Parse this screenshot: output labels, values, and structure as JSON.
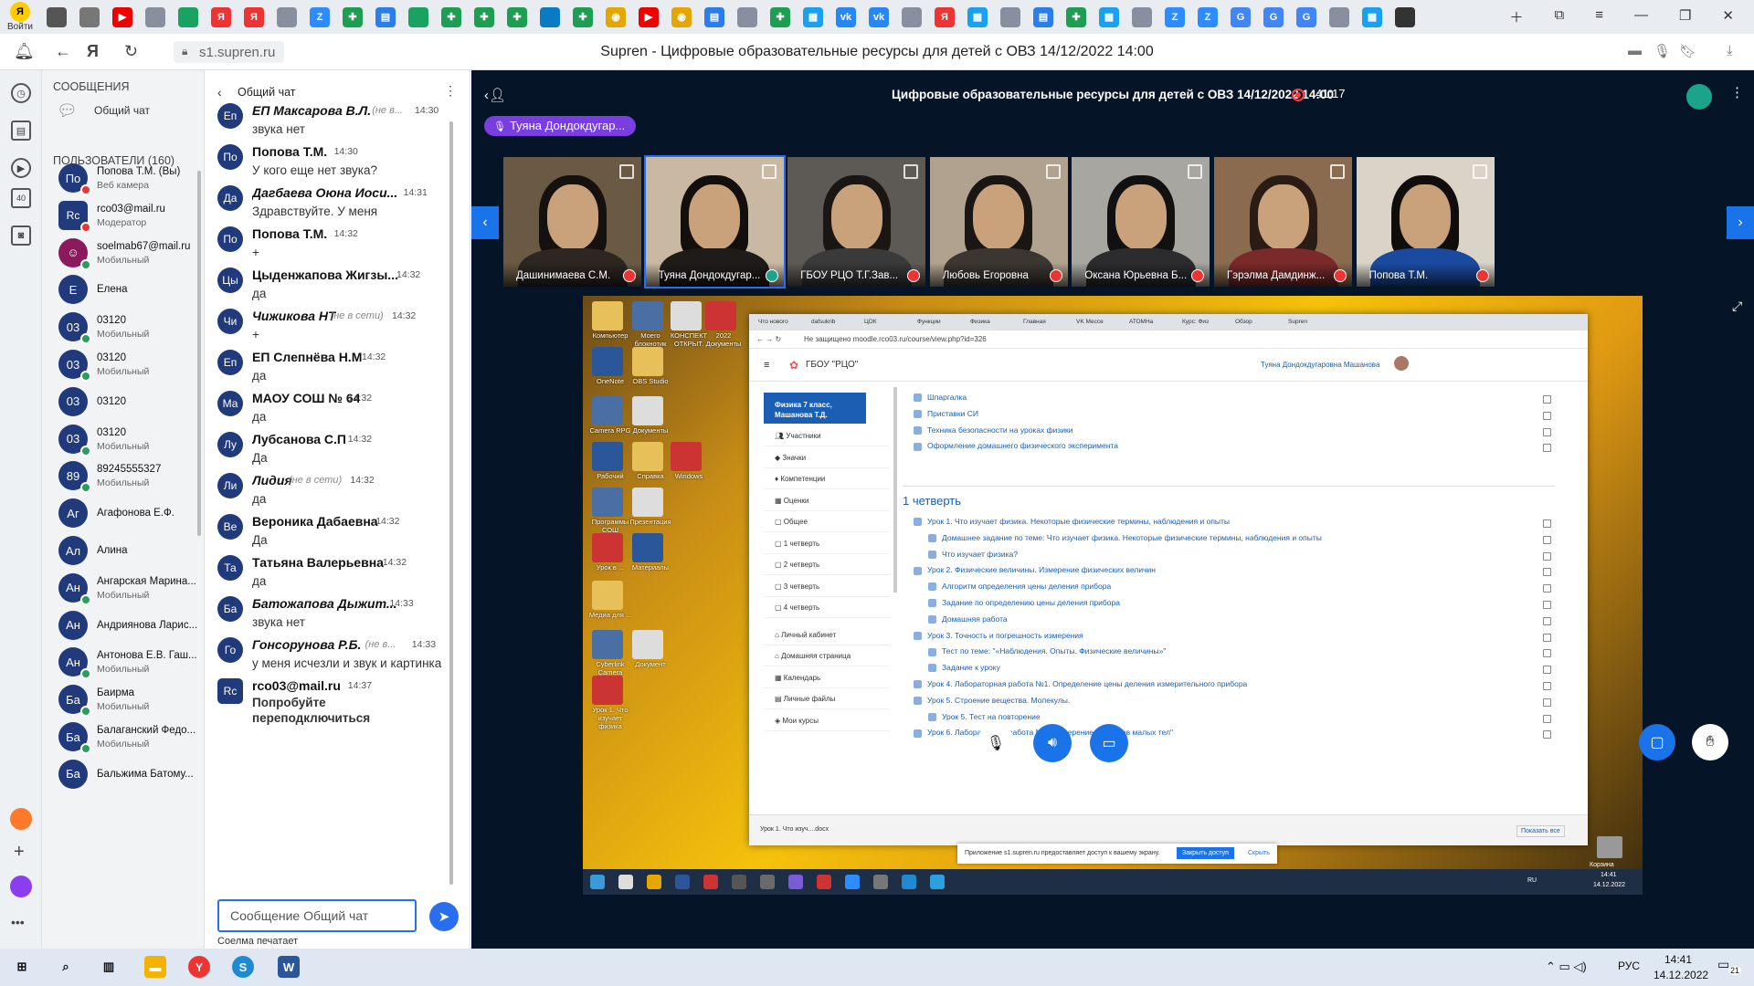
{
  "browser": {
    "login_label": "Войти",
    "url": "s1.supren.ru",
    "page_title": "Supren - Цифровые образовательные ресурсы для детей с ОВЗ 14/12/2022 14:00",
    "tab_icons": [
      "window-icon",
      "folder-icon",
      "youtube-icon",
      "app-icon",
      "drive-icon",
      "yandex-icon",
      "yandex-icon",
      "app-icon",
      "zoom-icon",
      "sheets-icon",
      "docs-icon",
      "drive-icon",
      "sheets-icon",
      "sheets-icon",
      "sheets-icon",
      "edge-icon",
      "sheets-icon",
      "chrome-icon",
      "youtube-icon",
      "chrome-icon",
      "docs-icon",
      "app-icon",
      "sheets-icon",
      "windows-icon",
      "vk-icon",
      "vk-icon",
      "app-icon",
      "yandex-icon",
      "windows-icon",
      "app-icon",
      "docs-icon",
      "sheets-icon",
      "windows-icon",
      "app-icon",
      "zoom-icon",
      "zoom-icon",
      "google-icon",
      "google-icon",
      "google-icon",
      "app-icon",
      "windows-icon",
      "supren-icon"
    ]
  },
  "users_panel": {
    "messages_header": "СООБЩЕНИЯ",
    "general_chat": "Общий чат",
    "users_header": "ПОЛЬЗОВАТЕЛИ (160)",
    "users": [
      {
        "initials": "По",
        "name": "Попова Т.М. (Вы)",
        "sub": "Веб камера",
        "color": "#213a7c",
        "badge": "#e33",
        "rc": false
      },
      {
        "initials": "Rc",
        "name": "rco03@mail.ru",
        "sub": "Модератор",
        "color": "#213a7c",
        "badge": "#e33",
        "rc": true
      },
      {
        "initials": "",
        "name": "soelmab67@mail.ru",
        "sub": "Мобильный",
        "color": "#8a1a5c",
        "badge": "#2a9d5c",
        "rc": false
      },
      {
        "initials": "Е",
        "name": "Елена",
        "sub": "",
        "color": "#213a7c",
        "badge": "",
        "rc": false
      },
      {
        "initials": "03",
        "name": "03120",
        "sub": "Мобильный",
        "color": "#213a7c",
        "badge": "#2a9d5c",
        "rc": false
      },
      {
        "initials": "03",
        "name": "03120",
        "sub": "Мобильный",
        "color": "#213a7c",
        "badge": "#2a9d5c",
        "rc": false
      },
      {
        "initials": "03",
        "name": "03120",
        "sub": "",
        "color": "#213a7c",
        "badge": "",
        "rc": false
      },
      {
        "initials": "03",
        "name": "03120",
        "sub": "Мобильный",
        "color": "#213a7c",
        "badge": "#2a9d5c",
        "rc": false
      },
      {
        "initials": "89",
        "name": "89245555327",
        "sub": "Мобильный",
        "color": "#213a7c",
        "badge": "#2a9d5c",
        "rc": false
      },
      {
        "initials": "Аг",
        "name": "Агафонова Е.Ф.",
        "sub": "",
        "color": "#213a7c",
        "badge": "",
        "rc": false
      },
      {
        "initials": "Ал",
        "name": "Алина",
        "sub": "",
        "color": "#213a7c",
        "badge": "",
        "rc": false
      },
      {
        "initials": "Ан",
        "name": "Ангарская Марина...",
        "sub": "Мобильный",
        "color": "#213a7c",
        "badge": "#2a9d5c",
        "rc": false
      },
      {
        "initials": "Ан",
        "name": "Андриянова Ларис...",
        "sub": "",
        "color": "#213a7c",
        "badge": "",
        "rc": false
      },
      {
        "initials": "Ан",
        "name": "Антонова Е.В. Гаш...",
        "sub": "Мобильный",
        "color": "#213a7c",
        "badge": "#2a9d5c",
        "rc": false
      },
      {
        "initials": "Ба",
        "name": "Баирма",
        "sub": "Мобильный",
        "color": "#213a7c",
        "badge": "#2a9d5c",
        "rc": false
      },
      {
        "initials": "Ба",
        "name": "Балаганский Федо...",
        "sub": "Мобильный",
        "color": "#213a7c",
        "badge": "#2a9d5c",
        "rc": false
      },
      {
        "initials": "Ба",
        "name": "Бальжима Батому...",
        "sub": "",
        "color": "#213a7c",
        "badge": "",
        "rc": false
      }
    ]
  },
  "chat": {
    "title": "Общий чат",
    "messages": [
      {
        "initials": "Еп",
        "name": "ЕП Максарова В.Л.",
        "status": "(не в...",
        "time": "14:30",
        "text": "звука нет",
        "italic": true,
        "rc": false
      },
      {
        "initials": "По",
        "name": "Попова Т.М.",
        "status": "",
        "time": "14:30",
        "text": "У кого еще нет звука?",
        "italic": false,
        "rc": false
      },
      {
        "initials": "Да",
        "name": "Дагбаева Оюна Иоси...",
        "status": "",
        "time": "14:31",
        "text": "Здравствуйте. У меня",
        "italic": true,
        "rc": false
      },
      {
        "initials": "По",
        "name": "Попова Т.М.",
        "status": "",
        "time": "14:32",
        "text": "+",
        "italic": false,
        "rc": false
      },
      {
        "initials": "Цы",
        "name": "Цыденжапова Жигзы...",
        "status": "",
        "time": "14:32",
        "text": "да",
        "italic": false,
        "rc": false
      },
      {
        "initials": "Чи",
        "name": "Чижикова НТ",
        "status": "(не в сети)",
        "time": "14:32",
        "text": "+",
        "italic": true,
        "rc": false
      },
      {
        "initials": "Еп",
        "name": "ЕП Слепнёва Н.М",
        "status": "",
        "time": "14:32",
        "text": "да",
        "italic": false,
        "rc": false
      },
      {
        "initials": "Ма",
        "name": "МАОУ СОШ № 64",
        "status": "",
        "time": "14:32",
        "text": "да",
        "italic": false,
        "rc": false
      },
      {
        "initials": "Лу",
        "name": "Лубсанова С.П",
        "status": "",
        "time": "14:32",
        "text": "Да",
        "italic": false,
        "rc": false
      },
      {
        "initials": "Ли",
        "name": "Лидия",
        "status": "(не в сети)",
        "time": "14:32",
        "text": "да",
        "italic": true,
        "rc": false
      },
      {
        "initials": "Ве",
        "name": "Вероника Дабаевна",
        "status": "",
        "time": "14:32",
        "text": "Да",
        "italic": false,
        "rc": false
      },
      {
        "initials": "Та",
        "name": "Татьяна Валерьевна",
        "status": "",
        "time": "14:32",
        "text": "да",
        "italic": false,
        "rc": false
      },
      {
        "initials": "Ба",
        "name": "Батожапова Дыжит...",
        "status": "",
        "time": "14:33",
        "text": "звука нет",
        "italic": true,
        "rc": false
      },
      {
        "initials": "Го",
        "name": "Гонсорунова Р.Б.",
        "status": "(не в...",
        "time": "14:33",
        "text": "у меня исчезли и звук и картинка",
        "italic": true,
        "rc": false
      },
      {
        "initials": "Rc",
        "name": "rco03@mail.ru",
        "status": "",
        "time": "14:37",
        "text": "Попробуйте переподключиться",
        "italic": false,
        "rc": true
      }
    ],
    "input_placeholder": "Сообщение Общий чат",
    "typing": "Соелма печатает"
  },
  "stage": {
    "title": "Цифровые образовательные ресурсы для детей с ОВЗ 14/12/2022 14:00",
    "timer": "41:17",
    "speaker": "Туяна Дондокдугар...",
    "tiles": [
      {
        "name": "Дашинимаева С.М.",
        "bg": "#6a5a44",
        "body": "#2d2622",
        "hair": "#15110e"
      },
      {
        "name": "Туяна Дондокдугар...",
        "bg": "#c9b9a2",
        "body": "#1f1b19",
        "hair": "#120f0d"
      },
      {
        "name": "ГБОУ РЦО Т.Г.Зав...",
        "bg": "#5d5a55",
        "body": "#3a3a3a",
        "hair": "#1a1614"
      },
      {
        "name": "Любовь Егоровна",
        "bg": "#b0a28e",
        "body": "#3c3632",
        "hair": "#1a1614"
      },
      {
        "name": "Оксана Юрьевна Б...",
        "bg": "#a7a6a1",
        "body": "#2c2c2e",
        "hair": "#121111"
      },
      {
        "name": "Гэрэлма Дамдинж...",
        "bg": "#8a6b50",
        "body": "#7a2a2a",
        "hair": "#2a1c14"
      },
      {
        "name": "Попова Т.М.",
        "bg": "#d9d3c8",
        "body": "#1a4aa0",
        "hair": "#100d0b"
      }
    ]
  },
  "shared_screen": {
    "desktop_icons": [
      "Компьютер",
      "Моего блокнотик",
      "КОНСПЕКТ ОТКРЫТ.",
      "2022 Документы",
      "OneNote",
      "OBS Studio",
      "Camera RPG",
      "Документы",
      "Windows",
      "Рабочий",
      "Справка",
      "Программы СОШ",
      "Презентация",
      "Урок в ...",
      "Материалы",
      "Медиа для ...",
      "Cyberlink Camera",
      "Документ",
      "Урок 1. Что изучает физика"
    ],
    "browser_tabs": [
      "Что нового",
      "dafsukrib",
      "ЦОК",
      "Функции",
      "Физика",
      "Главная",
      "VK Мессе",
      "АТОМНа",
      "Курс: Физ",
      "Обзор",
      "Supren"
    ],
    "url": "Не защищено  moodle.rco03.ru/course/view.php?id=326",
    "site_name": "ГБОУ \"РЦО\"",
    "user_name": "Туяна Дондокдугаровна Машанова",
    "course_title": "Физика 7 класс, Машанова Т.Д.",
    "nav": [
      "Участники",
      "Значки",
      "Компетенции",
      "Оценки",
      "Общее",
      "1 четверть",
      "2 четверть",
      "3 четверть",
      "4 четверть",
      "Личный кабинет",
      "Домашняя страница",
      "Календарь",
      "Личные файлы",
      "Мои курсы"
    ],
    "top_items": [
      "Шпаргалка",
      "Приставки СИ",
      "Техника безопасности на уроках физики",
      "Оформление домашнего физического эксперимента"
    ],
    "section_title": "1 четверть",
    "lessons": [
      {
        "text": "Урок 1. Что изучает физика. Некоторые физические термины, наблюдения и опыты",
        "indent": false
      },
      {
        "text": "Домашнее задание по теме: Что изучает физика. Некоторые физические термины, наблюдения и опыты",
        "indent": true
      },
      {
        "text": "Что изучает физика?",
        "indent": true
      },
      {
        "text": "Урок 2. Физические величины. Измерение физических величин",
        "indent": false
      },
      {
        "text": "Алгоритм определения цены деления прибора",
        "indent": true
      },
      {
        "text": "Задание по определению цены деления прибора",
        "indent": true
      },
      {
        "text": "Домашняя работа",
        "indent": true
      },
      {
        "text": "Урок 3. Точность и погрешность измерения",
        "indent": false
      },
      {
        "text": "Тест по теме: \"«Наблюдения. Опыты. Физические величины»\"",
        "indent": true
      },
      {
        "text": "Задание к уроку",
        "indent": true
      },
      {
        "text": "Урок 4. Лабораторная работа №1. Определение цены деления измерительного прибора",
        "indent": false
      },
      {
        "text": "Урок 5. Строение вещества. Молекулы.",
        "indent": false
      },
      {
        "text": "Урок 5. Тест на повторение",
        "indent": true
      },
      {
        "text": "Урок 6. Лабораторная работа №2 \"Измерение размеров малых тел\"",
        "indent": false
      }
    ],
    "download_item": "Урок 1. Что изуч....docx",
    "show_all": "Показать все",
    "notice_text": "Приложение s1.supren.ru предоставляет доступ к вашему экрану.",
    "notice_stop": "Закрыть доступ",
    "notice_hide": "Скрыть",
    "clock_time": "14:41",
    "clock_date": "14.12.2022",
    "lang": "RU",
    "trash_label": "Корзина"
  },
  "taskbar": {
    "lang": "РУС",
    "time": "14:41",
    "date": "14.12.2022",
    "notif_count": "21"
  },
  "colors": {
    "accent": "#2a6ef0",
    "stage_bg": "#061427",
    "speaker": "#7a3de0",
    "rec": "#ff3b3b"
  }
}
